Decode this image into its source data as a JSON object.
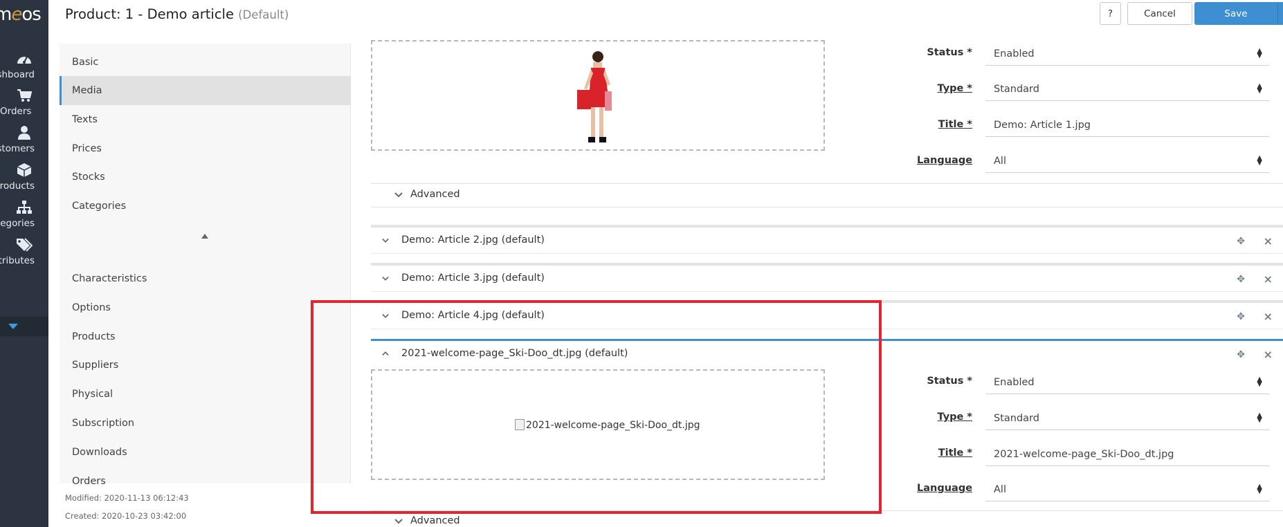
{
  "nav": {
    "logo": {
      "prefix": "m",
      "accent": "e",
      "suffix": "os"
    },
    "items": [
      {
        "label": "ashboard",
        "icon": "dashboard-icon"
      },
      {
        "label": "Orders",
        "icon": "cart-icon"
      },
      {
        "label": "ustomers",
        "icon": "user-icon"
      },
      {
        "label": "roducts",
        "icon": "box-icon"
      },
      {
        "label": "ategories",
        "icon": "sitemap-icon"
      },
      {
        "label": "ttributes",
        "icon": "tags-icon"
      }
    ]
  },
  "header": {
    "title": "Product: 1 - Demo article",
    "title_sub": "(Default)",
    "help_label": "?",
    "cancel_label": "Cancel",
    "save_label": "Save"
  },
  "sidebar": {
    "items": [
      "Basic",
      "Media",
      "Texts",
      "Prices",
      "Stocks",
      "Categories",
      "Characteristics",
      "Options",
      "Products",
      "Suppliers",
      "Physical",
      "Subscription",
      "Downloads",
      "Orders"
    ],
    "active": "Media",
    "modified": "Modified: 2020-11-13 06:12:43",
    "created": "Created: 2020-10-23 03:42:00"
  },
  "media": {
    "first": {
      "status_label": "Status *",
      "status_value": "Enabled",
      "type_label": "Type *",
      "type_value": "Standard",
      "title_label": "Title *",
      "title_value": "Demo: Article 1.jpg",
      "language_label": "Language",
      "language_value": "All",
      "advanced_label": "Advanced"
    },
    "collapsed": [
      "Demo: Article 2.jpg (default)",
      "Demo: Article 3.jpg (default)",
      "Demo: Article 4.jpg (default)"
    ],
    "open": {
      "header": "2021-welcome-page_Ski-Doo_dt.jpg (default)",
      "image_alt": "2021-welcome-page_Ski-Doo_dt.jpg",
      "status_label": "Status *",
      "status_value": "Enabled",
      "type_label": "Type *",
      "type_value": "Standard",
      "title_label": "Title *",
      "title_value": "2021-welcome-page_Ski-Doo_dt.jpg",
      "language_label": "Language",
      "language_value": "All",
      "advanced_label": "Advanced"
    }
  },
  "colors": {
    "accent": "#3d8fd1",
    "nav_bg": "#2b3440",
    "highlight": "#e3262d"
  }
}
